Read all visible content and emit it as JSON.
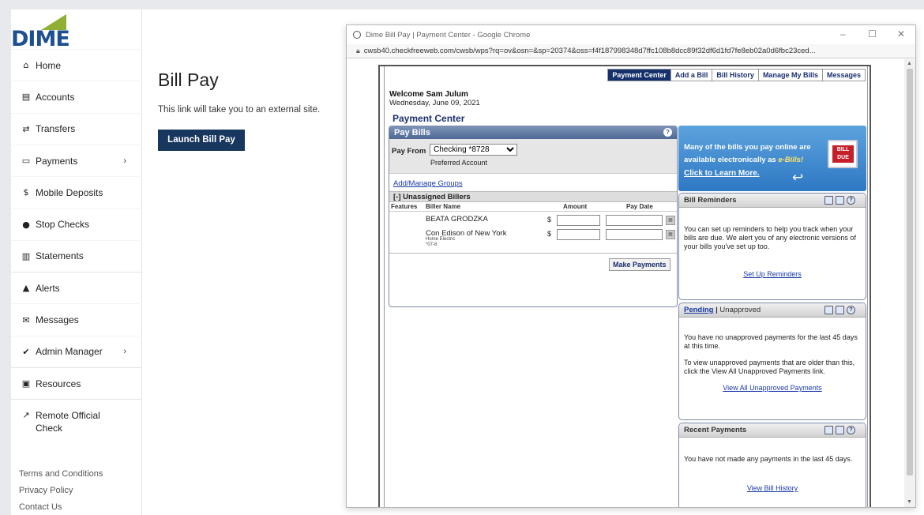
{
  "brand": {
    "name": "DIME",
    "colors": {
      "blue": "#1d4f91",
      "green": "#8fb034",
      "navy_button": "#17375e"
    }
  },
  "sidebar": {
    "items": [
      {
        "icon": "home-icon",
        "glyph": "⌂",
        "label": "Home"
      },
      {
        "icon": "accounts-icon",
        "glyph": "▤",
        "label": "Accounts"
      },
      {
        "icon": "transfers-icon",
        "glyph": "⇄",
        "label": "Transfers"
      },
      {
        "icon": "payments-icon",
        "glyph": "▭",
        "label": "Payments",
        "chevron": "›"
      },
      {
        "icon": "dollar-icon",
        "glyph": "$",
        "label": "Mobile Deposits"
      },
      {
        "icon": "stop-icon",
        "glyph": "●",
        "label": "Stop Checks"
      },
      {
        "icon": "statements-icon",
        "glyph": "▥",
        "label": "Statements"
      },
      {
        "icon": "bell-icon",
        "glyph": "▲",
        "label": "Alerts"
      },
      {
        "icon": "envelope-icon",
        "glyph": "✉",
        "label": "Messages"
      },
      {
        "icon": "check-circle-icon",
        "glyph": "✔",
        "label": "Admin Manager",
        "chevron": "›"
      },
      {
        "icon": "resources-icon",
        "glyph": "▣",
        "label": "Resources"
      },
      {
        "icon": "external-link-icon",
        "glyph": "↗",
        "label": "Remote Official Check"
      }
    ],
    "footer": [
      "Terms and Conditions",
      "Privacy Policy",
      "Contact Us"
    ]
  },
  "main": {
    "title": "Bill Pay",
    "note": "This link will take you to an external site.",
    "button": "Launch Bill Pay"
  },
  "popup": {
    "window_title": "Dime Bill Pay | Payment Center - Google Chrome",
    "url": "cwsb40.checkfreeweb.com/cwsb/wps?rq=ov&osn=&sp=20374&oss=f4f187998348d7ffc108b8dcc89f32df6d1fd7fe8eb02a0d6fbc23ced...",
    "controls": {
      "minimize": "–",
      "maximize": "☐",
      "close": "✕"
    }
  },
  "checkfree": {
    "tabs": [
      "Payment Center",
      "Add a Bill",
      "Bill History",
      "Manage My Bills",
      "Messages"
    ],
    "welcome": "Welcome Sam Julum",
    "date": "Wednesday, June 09, 2021",
    "page_title": "Payment Center",
    "pay_bills": {
      "title": "Pay Bills",
      "help": "?",
      "pay_from_label": "Pay From",
      "account": "Checking *8728",
      "preferred": "Preferred Account",
      "add_manage": "Add/Manage Groups",
      "group": "[-]  Unassigned Billers",
      "columns": {
        "features": "Features",
        "biller": "Biller Name",
        "amount": "Amount",
        "pay_date": "Pay Date"
      },
      "billers": [
        {
          "name": "BEATA GRODZKA",
          "sub1": "",
          "sub2": ""
        },
        {
          "name": "Con Edison of New York",
          "sub1": "Home Electric",
          "sub2": "*07-8"
        }
      ],
      "currency": "$",
      "make_payments": "Make Payments"
    },
    "ebill": {
      "line1": "Many of the bills you pay online are",
      "line2": "available electronically as",
      "emph": "e-Bills!",
      "link": "Click to Learn More.",
      "badge1": "BILL",
      "badge2": "DUE"
    },
    "reminders": {
      "title": "Bill Reminders",
      "body": "You can set up reminders to help you track when your bills are due. We alert you of any electronic versions of your bills you've set up too.",
      "link": "Set Up Reminders"
    },
    "pending": {
      "tab_pending": "Pending",
      "sep": " | ",
      "tab_unapproved": "Unapproved",
      "body1": "You have no unapproved payments for the last 45 days at this time.",
      "body2": "To view unapproved payments that are older than this, click the View All Unapproved Payments link.",
      "link": "View All Unapproved Payments"
    },
    "recent": {
      "title": "Recent Payments",
      "body": "You have not made any payments in the last 45 days.",
      "link": "View Bill History"
    }
  }
}
